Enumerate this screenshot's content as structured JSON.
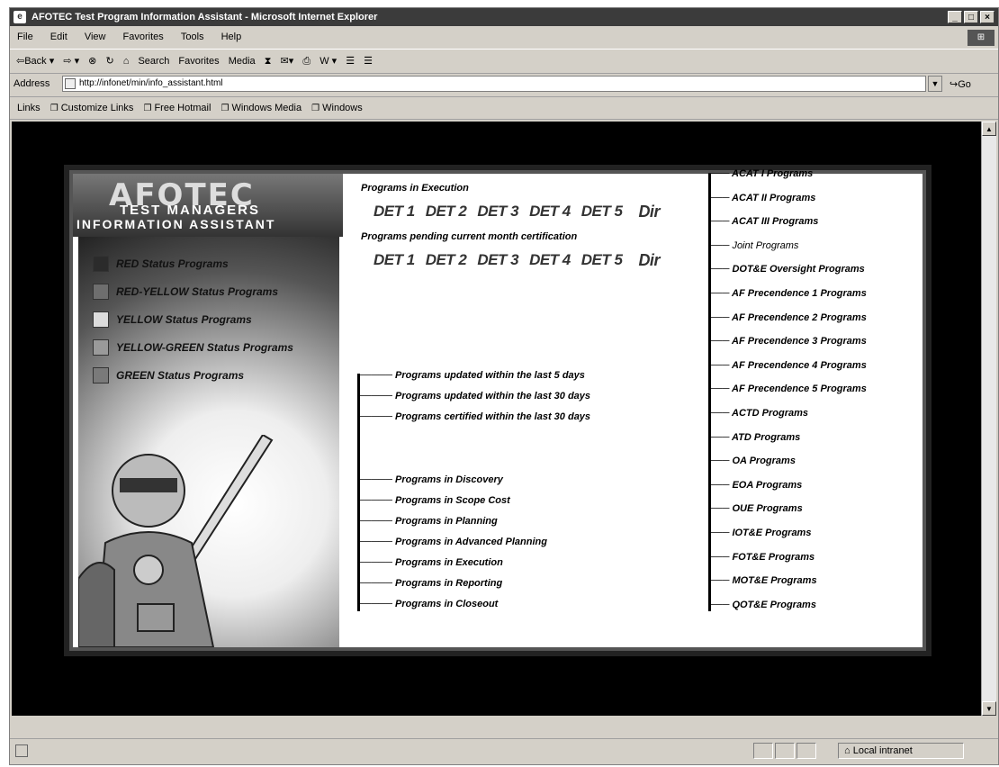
{
  "window": {
    "title": "AFOTEC Test Program Information Assistant - Microsoft Internet Explorer",
    "buttons": [
      "_",
      "□",
      "×"
    ]
  },
  "menu": [
    "File",
    "Edit",
    "View",
    "Favorites",
    "Tools",
    "Help"
  ],
  "toolbar": [
    "⇦Back ▾",
    "⇨ ▾",
    "⊗",
    "↻",
    "⌂",
    "Search",
    "Favorites",
    "Media",
    "⧗",
    "✉▾",
    "⎙",
    "W ▾",
    "☰",
    "☰"
  ],
  "address": {
    "label": "Address",
    "url": "http://infonet/min/info_assistant.html",
    "go": "Go"
  },
  "links": {
    "label": "Links",
    "items": [
      "Customize Links",
      "Free Hotmail",
      "Windows Media",
      "Windows"
    ]
  },
  "status": {
    "zone": "Local intranet"
  },
  "page": {
    "logo": "AFOTEC",
    "subtitle1": "TEST MANAGERS",
    "subtitle2": "INFORMATION ASSISTANT",
    "status_programs": [
      {
        "label": "RED Status Programs",
        "color": "#2b2b2b"
      },
      {
        "label": "RED-YELLOW Status Programs",
        "color": "#6e6e6e"
      },
      {
        "label": "YELLOW Status Programs",
        "color": "#dcdcdc"
      },
      {
        "label": "YELLOW-GREEN Status Programs",
        "color": "#9a9a9a"
      },
      {
        "label": "GREEN Status Programs",
        "color": "#7a7a7a"
      }
    ],
    "execution_heading": "Programs in Execution",
    "execution_dets": [
      "DET 1",
      "DET 2",
      "DET 3",
      "DET 4",
      "DET 5",
      "Dir"
    ],
    "pending_heading": "Programs pending current month certification",
    "pending_dets": [
      "DET 1",
      "DET 2",
      "DET 3",
      "DET 4",
      "DET 5",
      "Dir"
    ],
    "updates": [
      "Programs updated within the last 5 days",
      "Programs updated within the last 30 days",
      "Programs certified within the last 30 days"
    ],
    "phases": [
      "Programs in Discovery",
      "Programs in Scope Cost",
      "Programs in Planning",
      "Programs in Advanced Planning",
      "Programs in Execution",
      "Programs in Reporting",
      "Programs in Closeout"
    ],
    "categories": [
      "ACAT I Programs",
      "ACAT II Programs",
      "ACAT III Programs",
      "Joint Programs",
      "DOT&E Oversight Programs",
      "AF Precendence 1 Programs",
      "AF Precendence 2 Programs",
      "AF Precendence 3 Programs",
      "AF Precendence 4 Programs",
      "AF Precendence 5 Programs",
      "ACTD Programs",
      "ATD Programs",
      "OA Programs",
      "EOA Programs",
      "OUE Programs",
      "IOT&E Programs",
      "FOT&E Programs",
      "MOT&E Programs",
      "QOT&E Programs"
    ]
  }
}
